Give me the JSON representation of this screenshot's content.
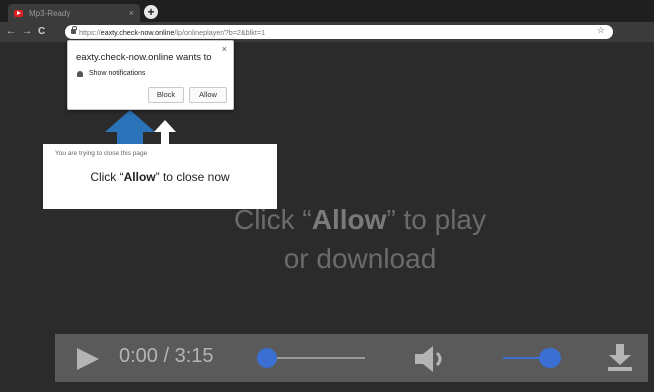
{
  "tab": {
    "title": "Mp3-Ready",
    "close": "×",
    "new_tab": "+"
  },
  "toolbar": {
    "back": "←",
    "forward": "→",
    "reload": "C",
    "url_prefix": "https://",
    "url_host": "eaxty.check-now.online",
    "url_path": "/lp/onlineplayer/?b=2&blkt=1",
    "star": "☆"
  },
  "notification": {
    "title": "eaxty.check-now.online wants to",
    "close": "×",
    "permission": "Show notifications",
    "block_label": "Block",
    "allow_label": "Allow"
  },
  "close_box": {
    "subtitle": "You are trying to close this page",
    "prefix": "Click “",
    "bold": "Allow",
    "suffix": "” to close now"
  },
  "main_message": {
    "prefix": "Click “",
    "bold": "Allow",
    "suffix": "” to play",
    "line2": "or download"
  },
  "player": {
    "time": "0:00 / 3:15",
    "seek_fraction": 0.0,
    "volume_fraction": 1.0
  },
  "colors": {
    "accent": "#3b6fd1",
    "arrow": "#2a73b8",
    "favicon": "#e02020"
  }
}
